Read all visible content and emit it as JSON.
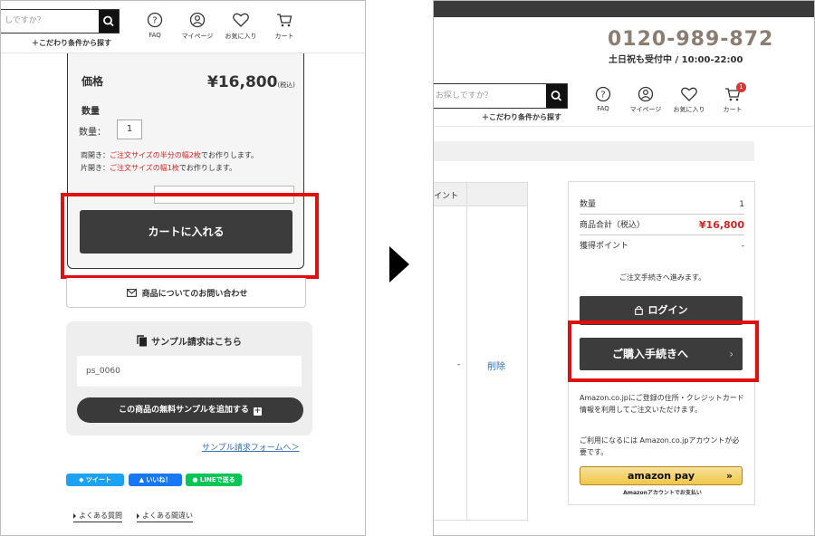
{
  "left": {
    "header": {
      "search_placeholder": "しですか？",
      "condition_link": "＋こだわり条件から探す",
      "icons": [
        {
          "name": "faq-icon",
          "label": "FAQ"
        },
        {
          "name": "user-icon",
          "label": "マイページ"
        },
        {
          "name": "heart-icon",
          "label": "お気に入り"
        },
        {
          "name": "cart-icon",
          "label": "カート"
        }
      ]
    },
    "product": {
      "price_label": "価格",
      "price_value": "¥16,800",
      "tax_note": "(税込)",
      "qty_heading": "数量",
      "qty_label": "数量：",
      "qty_value": "1",
      "note1_prefix": "両開き：",
      "note1_red": "ご注文サイズの半分の幅2枚",
      "note1_suffix": "でお作りします。",
      "note2_prefix": "片開き：",
      "note2_red": "ご注文サイズの幅1枚",
      "note2_suffix": "でお作りします。",
      "add_to_cart": "カートに入れる"
    },
    "inquiry_label": "商品についてのお問い合わせ",
    "sample": {
      "title": "サンプル請求はこちら",
      "code": "ps_0060",
      "add_button": "この商品の無料サンプルを追加する",
      "form_link": "サンプル請求フォームへ＞"
    },
    "sns": {
      "tweet": "ツイート",
      "like": "いいね！",
      "line": "LINEで送る"
    },
    "footer_links": [
      "よくある質問",
      "よくある間違い"
    ]
  },
  "right": {
    "header": {
      "phone": "0120-989-872",
      "hours": "土日祝も受付中 / 10:00-22:00",
      "search_placeholder": "お探しですか？",
      "condition_link": "＋こだわり条件から探す",
      "cart_count": "1",
      "icons": [
        {
          "name": "faq-icon",
          "label": "FAQ"
        },
        {
          "name": "user-icon",
          "label": "マイページ"
        },
        {
          "name": "heart-icon",
          "label": "お気に入り"
        },
        {
          "name": "cart-icon",
          "label": "カート"
        }
      ]
    },
    "table": {
      "header_partial": "イント",
      "dash": "-",
      "delete": "削除"
    },
    "summary": {
      "qty_label": "数量",
      "qty_value": "1",
      "subtotal_label": "商品合計（税込）",
      "subtotal_value": "¥16,800",
      "points_label": "獲得ポイント",
      "points_value": "-",
      "proceed_note": "ご注文手続きへ進みます。",
      "login": "ログイン",
      "checkout": "ご購入手続きへ",
      "amazon_text1": "Amazon.co.jpにご登録の住所・クレジットカード情報を利用してご注文いただけます。",
      "amazon_text2": "ご利用になるには Amazon.co.jpアカウントが必要です。",
      "amazon_pay": "amazon pay",
      "amazon_sub": "Amazonアカウントでお支払い"
    }
  },
  "colors": {
    "highlight": "#e01010",
    "button_dark": "#3c3c3c",
    "link_blue": "#3b6fb6",
    "price_red": "#d22222",
    "phone_brown": "#8a7d72"
  }
}
